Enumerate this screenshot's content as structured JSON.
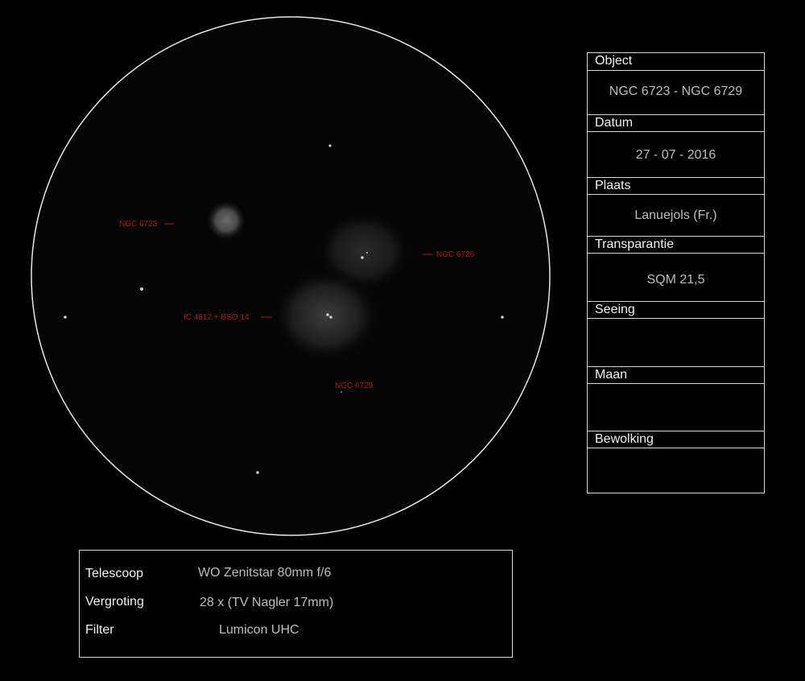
{
  "objects": {
    "ngc6723": "NGC 6723",
    "ngc6726": "NGC 6726",
    "ic4812": "IC 4812 + BSO 14",
    "ngc6729": "NGC 6729"
  },
  "info": {
    "object_label": "Object",
    "object_value": "NGC 6723 - NGC 6729",
    "datum_label": "Datum",
    "datum_value": "27 - 07 - 2016",
    "plaats_label": "Plaats",
    "plaats_value": "Lanuejols (Fr.)",
    "transparantie_label": "Transparantie",
    "transparantie_value": "SQM 21,5",
    "seeing_label": "Seeing",
    "seeing_value": "",
    "maan_label": "Maan",
    "maan_value": "",
    "bewolking_label": "Bewolking",
    "bewolking_value": ""
  },
  "equipment": {
    "telescoop_label": "Telescoop",
    "telescoop_value": "WO Zenitstar 80mm f/6",
    "vergroting_label": "Vergroting",
    "vergroting_value": "28 x (TV Nagler 17mm)",
    "filter_label": "Filter",
    "filter_value": "Lumicon UHC"
  }
}
